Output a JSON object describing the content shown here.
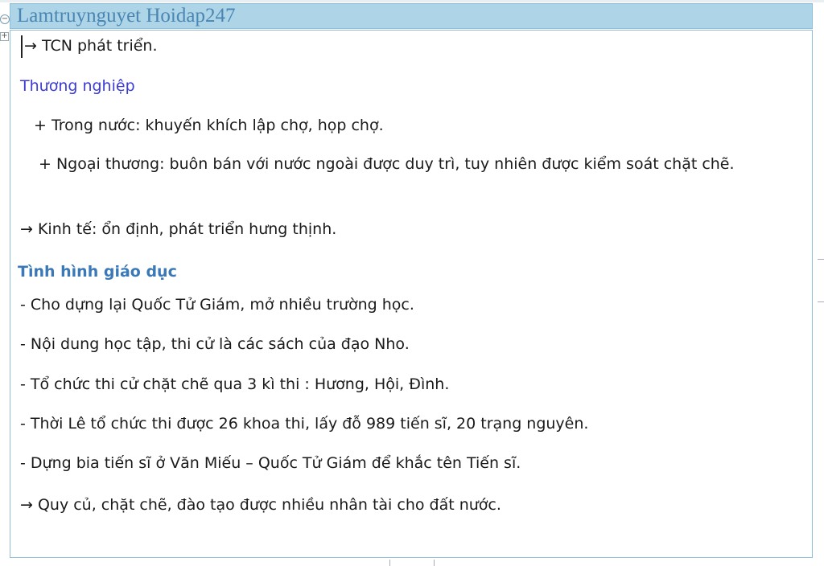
{
  "header": {
    "title": "Lamtruynguyet  Hoidap247"
  },
  "content": {
    "lines": [
      "→ TCN phát triển.",
      "Thương nghiệp",
      "+ Trong nước: khuyến khích lập chợ, họp chợ.",
      "+ Ngoại thương: buôn bán với nước ngoài được duy trì, tuy nhiên được kiểm soát chặt chẽ.",
      "→ Kinh tế: ổn định, phát triển hưng thịnh.",
      "Tình hình giáo dục",
      "- Cho dựng lại Quốc Tử Giám, mở nhiều trường học.",
      "- Nội dung học tập, thi cử là các sách của đạo Nho.",
      "- Tổ chức thi cử chặt chẽ qua 3 kì thi : Hương, Hội, Đình.",
      "- Thời Lê tổ chức thi được 26 khoa thi, lấy đỗ 989 tiến sĩ, 20 trạng nguyên.",
      "- Dựng bia tiến sĩ ở Văn Miếu – Quốc Tử Giám để khắc tên Tiến sĩ.",
      "→ Quy củ, chặt chẽ, đào tạo được nhiều nhân tài cho đất nước."
    ]
  },
  "colors": {
    "header_bg": "#add5e7",
    "header_text": "#4a86b4",
    "heading_blue": "#3b3bd6",
    "heading_steel": "#3a78b8",
    "frame_border": "#8fbfd6"
  }
}
